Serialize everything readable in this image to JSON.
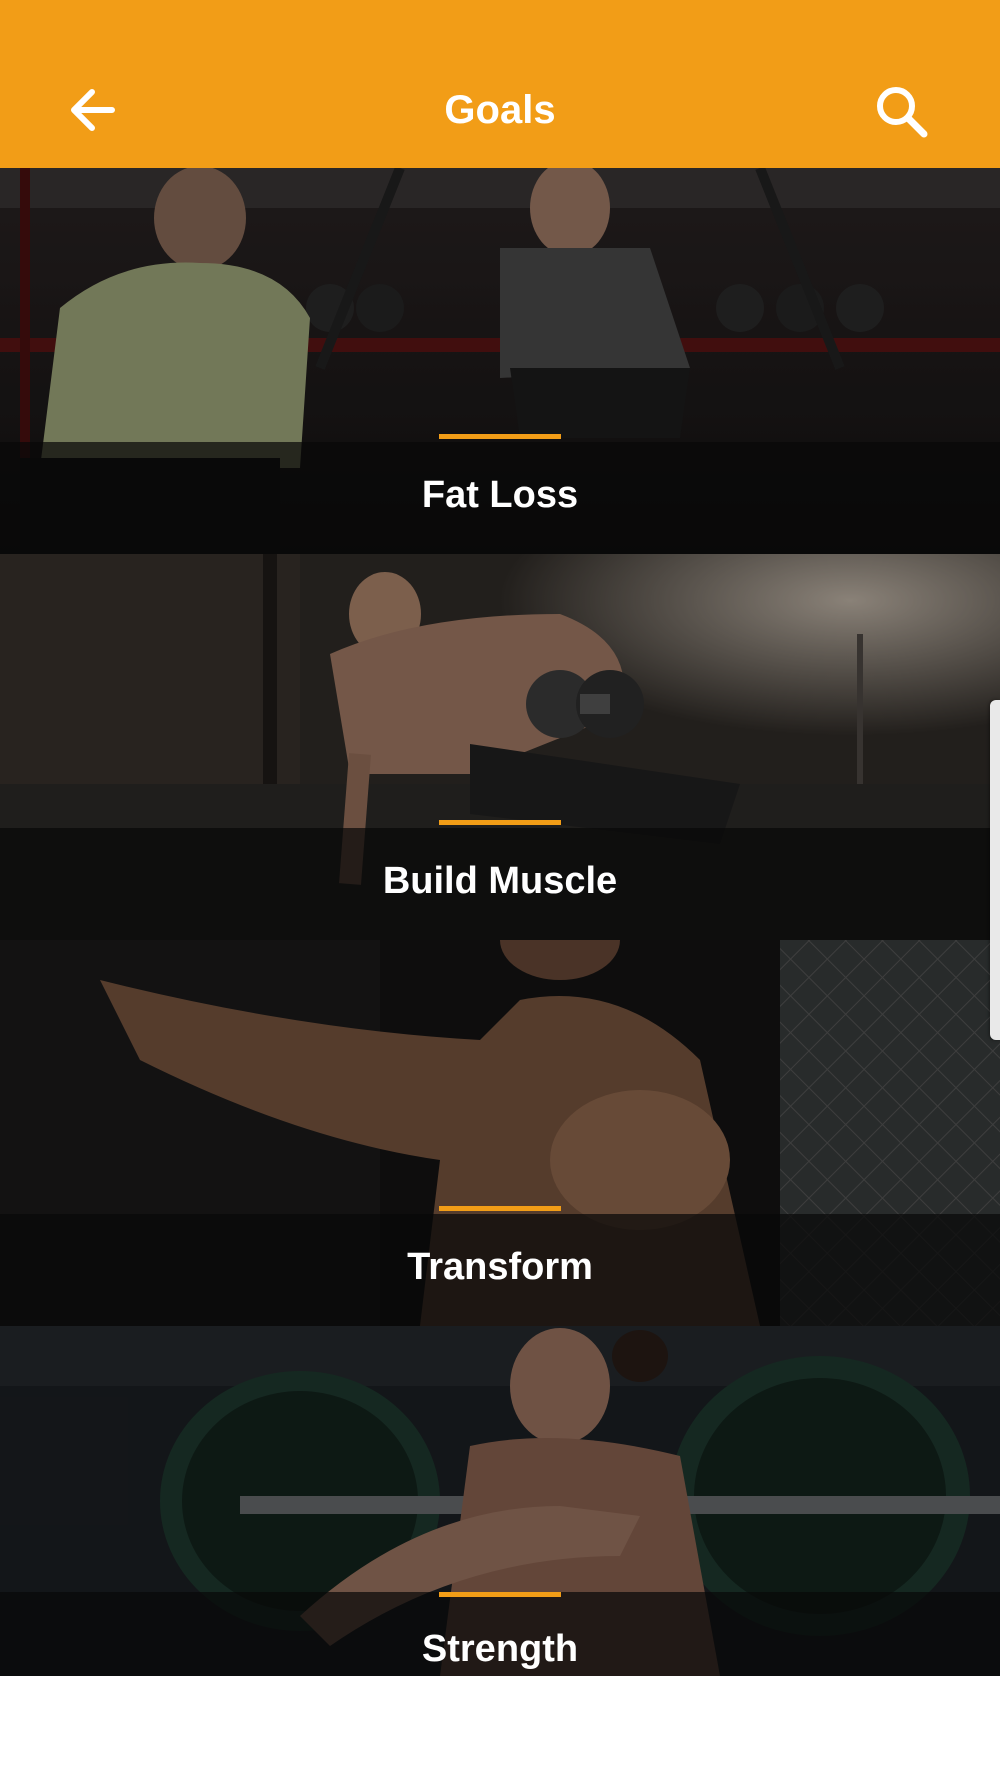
{
  "app_bar": {
    "title": "Goals",
    "back_icon": "arrow-left-icon",
    "search_icon": "search-icon",
    "color": "#F29D17"
  },
  "goals": [
    {
      "label": "Fat Loss"
    },
    {
      "label": "Build Muscle"
    },
    {
      "label": "Transform"
    },
    {
      "label": "Strength"
    }
  ],
  "accent_color": "#F29D17"
}
